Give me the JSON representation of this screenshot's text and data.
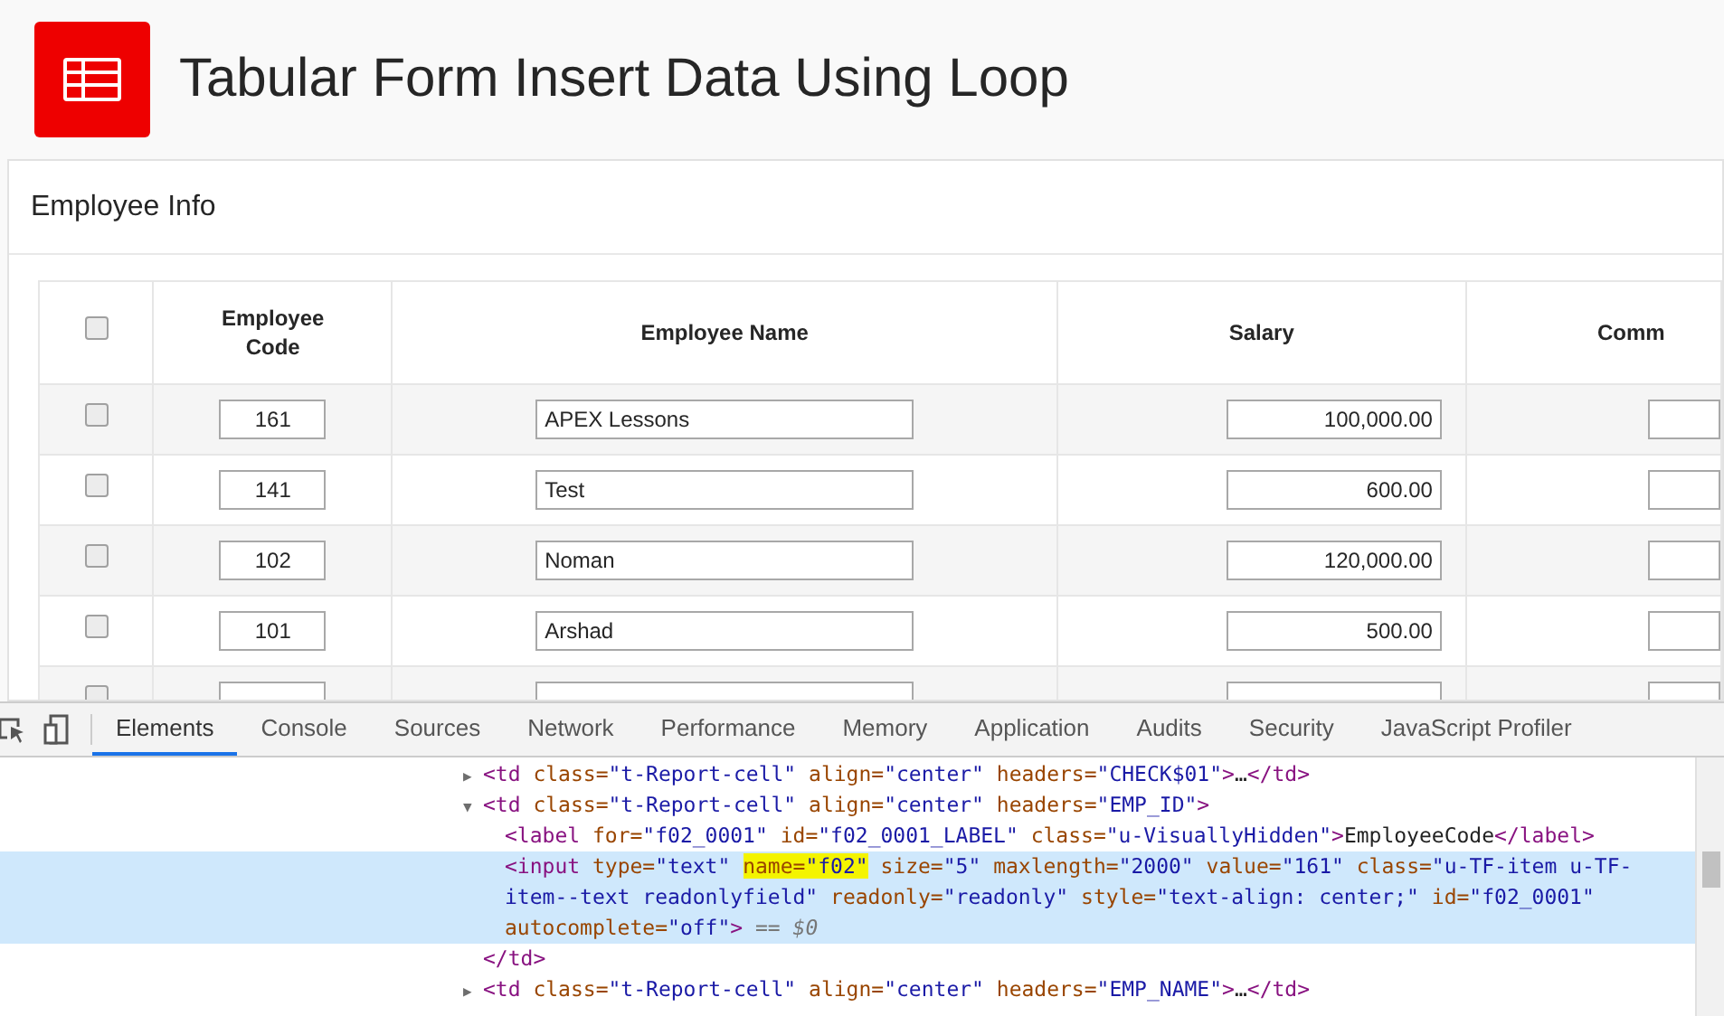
{
  "page_title": "Tabular Form Insert Data Using Loop",
  "region": {
    "title": "Employee Info",
    "table": {
      "select_all": {
        "checked": false
      },
      "columns": [
        "Employee Code",
        "Employee Name",
        "Salary",
        "Comm"
      ],
      "rows": [
        {
          "checked": false,
          "code": "161",
          "name": "APEX Lessons",
          "salary": "100,000.00"
        },
        {
          "checked": false,
          "code": "141",
          "name": "Test",
          "salary": "600.00"
        },
        {
          "checked": false,
          "code": "102",
          "name": "Noman",
          "salary": "120,000.00"
        },
        {
          "checked": false,
          "code": "101",
          "name": "Arshad",
          "salary": "500.00"
        },
        {
          "checked": false
        }
      ]
    }
  },
  "devtools": {
    "tabs": [
      {
        "label": "Elements",
        "selected": true
      },
      {
        "label": "Console",
        "selected": false
      },
      {
        "label": "Sources",
        "selected": false
      },
      {
        "label": "Network",
        "selected": false
      },
      {
        "label": "Performance",
        "selected": false
      },
      {
        "label": "Memory",
        "selected": false
      },
      {
        "label": "Application",
        "selected": false
      },
      {
        "label": "Audits",
        "selected": false
      },
      {
        "label": "Security",
        "selected": false
      },
      {
        "label": "JavaScript Profiler",
        "selected": false
      }
    ],
    "lines": [
      {
        "expander": "▶",
        "selected": false,
        "tokens": [
          {
            "kind": "tag",
            "text": "<td"
          },
          {
            "kind": "attr",
            "text": " class="
          },
          {
            "kind": "value",
            "text": "\"t-Report-cell\""
          },
          {
            "kind": "attr",
            "text": " align="
          },
          {
            "kind": "value",
            "text": "\"center\""
          },
          {
            "kind": "attr",
            "text": " headers="
          },
          {
            "kind": "value",
            "text": "\"CHECK$01\""
          },
          {
            "kind": "tag",
            "text": ">"
          },
          {
            "kind": "text",
            "text": "…"
          },
          {
            "kind": "tag",
            "text": "</td>"
          }
        ]
      },
      {
        "expander": "▼",
        "selected": false,
        "tokens": [
          {
            "kind": "tag",
            "text": "<td"
          },
          {
            "kind": "attr",
            "text": " class="
          },
          {
            "kind": "value",
            "text": "\"t-Report-cell\""
          },
          {
            "kind": "attr",
            "text": " align="
          },
          {
            "kind": "value",
            "text": "\"center\""
          },
          {
            "kind": "attr",
            "text": " headers="
          },
          {
            "kind": "value",
            "text": "\"EMP_ID\""
          },
          {
            "kind": "tag",
            "text": ">"
          }
        ],
        "closing": {
          "selected": false,
          "tokens": [
            {
              "kind": "tag",
              "text": "</td>"
            }
          ]
        },
        "children": [
          {
            "selected": false,
            "tokens": [
              {
                "kind": "tag",
                "text": "<label"
              },
              {
                "kind": "attr",
                "text": " for="
              },
              {
                "kind": "value",
                "text": "\"f02_0001\""
              },
              {
                "kind": "attr",
                "text": " id="
              },
              {
                "kind": "value",
                "text": "\"f02_0001_LABEL\""
              },
              {
                "kind": "attr",
                "text": " class="
              },
              {
                "kind": "value",
                "text": "\"u-VisuallyHidden\""
              },
              {
                "kind": "tag",
                "text": ">"
              },
              {
                "kind": "text",
                "text": "EmployeeCode"
              },
              {
                "kind": "tag",
                "text": "</label>"
              }
            ]
          },
          {
            "selected": true,
            "tokens": [
              {
                "kind": "tag",
                "text": "<input"
              },
              {
                "kind": "attr",
                "text": " type="
              },
              {
                "kind": "value",
                "text": "\"text\" "
              },
              {
                "kind": "attr",
                "text": "name=",
                "highlighted": true
              },
              {
                "kind": "value",
                "text": "\"f02\"",
                "highlighted": true
              },
              {
                "kind": "attr",
                "text": " size="
              },
              {
                "kind": "value",
                "text": "\"5\""
              },
              {
                "kind": "attr",
                "text": " maxlength="
              },
              {
                "kind": "value",
                "text": "\"2000\""
              },
              {
                "kind": "attr",
                "text": " value="
              },
              {
                "kind": "value",
                "text": "\"161\""
              },
              {
                "kind": "attr",
                "text": " class="
              },
              {
                "kind": "value",
                "text": "\"u-TF-item u-TF-item--text readonlyfield\""
              },
              {
                "kind": "attr",
                "text": " readonly="
              },
              {
                "kind": "value",
                "text": "\"readonly\""
              },
              {
                "kind": "attr",
                "text": " style="
              },
              {
                "kind": "value",
                "text": "\"text-align: center;\""
              },
              {
                "kind": "attr",
                "text": " id="
              },
              {
                "kind": "value",
                "text": "\"f02_0001\""
              },
              {
                "kind": "attr",
                "text": " autocomplete="
              },
              {
                "kind": "value",
                "text": "\"off\""
              },
              {
                "kind": "tag",
                "text": ">"
              },
              {
                "kind": "note",
                "text": " == $0"
              }
            ]
          }
        ]
      },
      {
        "expander": "▶",
        "selected": false,
        "tokens": [
          {
            "kind": "tag",
            "text": "<td"
          },
          {
            "kind": "attr",
            "text": " class="
          },
          {
            "kind": "value",
            "text": "\"t-Report-cell\""
          },
          {
            "kind": "attr",
            "text": " align="
          },
          {
            "kind": "value",
            "text": "\"center\""
          },
          {
            "kind": "attr",
            "text": " headers="
          },
          {
            "kind": "value",
            "text": "\"EMP_NAME\""
          },
          {
            "kind": "tag",
            "text": ">"
          },
          {
            "kind": "text",
            "text": "…"
          },
          {
            "kind": "tag",
            "text": "</td>"
          }
        ]
      }
    ]
  }
}
